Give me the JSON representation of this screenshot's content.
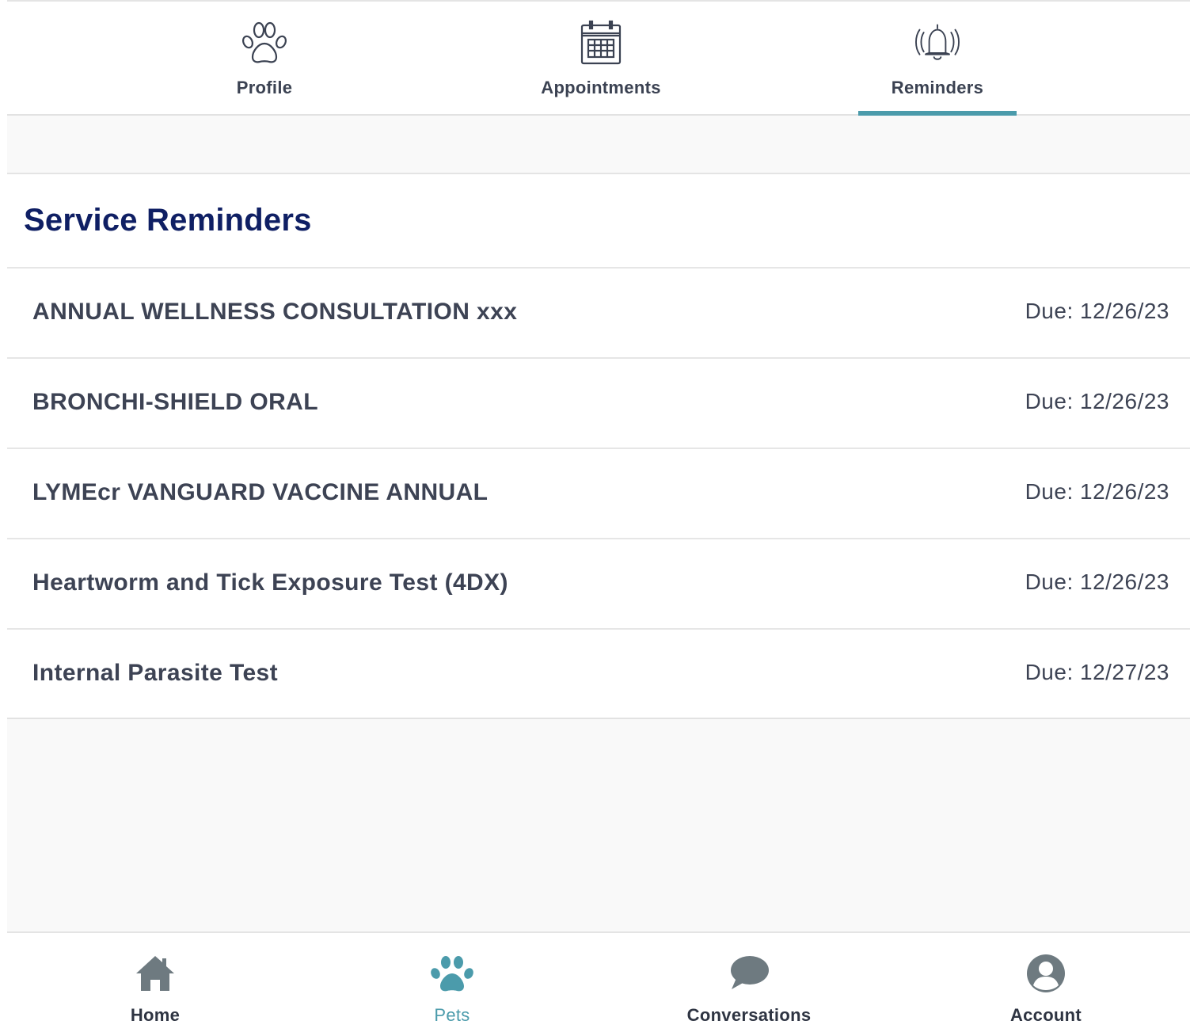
{
  "top_tabs": [
    {
      "label": "Profile",
      "icon": "paw-outline-icon",
      "active": false
    },
    {
      "label": "Appointments",
      "icon": "calendar-icon",
      "active": false
    },
    {
      "label": "Reminders",
      "icon": "bell-ringing-icon",
      "active": true
    }
  ],
  "reminders": {
    "title": "Service Reminders",
    "items": [
      {
        "name": "ANNUAL WELLNESS CONSULTATION xxx",
        "due": "Due: 12/26/23"
      },
      {
        "name": "BRONCHI-SHIELD ORAL",
        "due": "Due: 12/26/23"
      },
      {
        "name": "LYMEcr VANGUARD VACCINE ANNUAL",
        "due": "Due: 12/26/23"
      },
      {
        "name": "Heartworm and Tick Exposure Test (4DX)",
        "due": "Due: 12/26/23"
      },
      {
        "name": "Internal Parasite Test",
        "due": "Due: 12/27/23"
      }
    ]
  },
  "bottom_nav": [
    {
      "label": "Home",
      "icon": "home-icon",
      "active": false
    },
    {
      "label": "Pets",
      "icon": "paw-icon",
      "active": true
    },
    {
      "label": "Conversations",
      "icon": "chat-bubble-icon",
      "active": false
    },
    {
      "label": "Account",
      "icon": "account-icon",
      "active": false
    }
  ],
  "colors": {
    "accent": "#4b9bab",
    "title": "#0f1f64",
    "text": "#3d4354",
    "nav_icon": "#6e7a80",
    "background": "#f9f9f9"
  }
}
